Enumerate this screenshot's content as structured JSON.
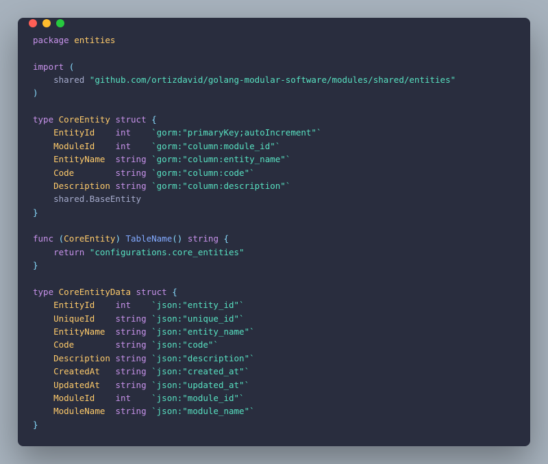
{
  "titlebar": {
    "red": "",
    "yellow": "",
    "green": ""
  },
  "code": {
    "pkg_kw": "package",
    "pkg_name": "entities",
    "import_kw": "import",
    "import_open": "(",
    "import_alias": "shared",
    "import_path": "\"github.com/ortizdavid/golang-modular-software/modules/shared/entities\"",
    "import_close": ")",
    "type_kw": "type",
    "struct_kw": "struct",
    "func_kw": "func",
    "return_kw": "return",
    "brace_open": "{",
    "brace_close": "}",
    "paren_open": "(",
    "paren_close": ")",
    "core_entity": "CoreEntity",
    "core_fields": [
      {
        "name": "EntityId",
        "type": "int",
        "tag": "`gorm:\"primaryKey;autoIncrement\"`"
      },
      {
        "name": "ModuleId",
        "type": "int",
        "tag": "`gorm:\"column:module_id\"`"
      },
      {
        "name": "EntityName",
        "type": "string",
        "tag": "`gorm:\"column:entity_name\"`"
      },
      {
        "name": "Code",
        "type": "string",
        "tag": "`gorm:\"column:code\"`"
      },
      {
        "name": "Description",
        "type": "string",
        "tag": "`gorm:\"column:description\"`"
      }
    ],
    "embedded": "shared.BaseEntity",
    "tablename_fn": "TableName",
    "tablename_ret": "string",
    "tablename_val": "\"configurations.core_entities\"",
    "core_entity_data": "CoreEntityData",
    "data_fields": [
      {
        "name": "EntityId",
        "type": "int",
        "tag": "`json:\"entity_id\"`"
      },
      {
        "name": "UniqueId",
        "type": "string",
        "tag": "`json:\"unique_id\"`"
      },
      {
        "name": "EntityName",
        "type": "string",
        "tag": "`json:\"entity_name\"`"
      },
      {
        "name": "Code",
        "type": "string",
        "tag": "`json:\"code\"`"
      },
      {
        "name": "Description",
        "type": "string",
        "tag": "`json:\"description\"`"
      },
      {
        "name": "CreatedAt",
        "type": "string",
        "tag": "`json:\"created_at\"`"
      },
      {
        "name": "UpdatedAt",
        "type": "string",
        "tag": "`json:\"updated_at\"`"
      },
      {
        "name": "ModuleId",
        "type": "int",
        "tag": "`json:\"module_id\"`"
      },
      {
        "name": "ModuleName",
        "type": "string",
        "tag": "`json:\"module_name\"`"
      }
    ]
  }
}
